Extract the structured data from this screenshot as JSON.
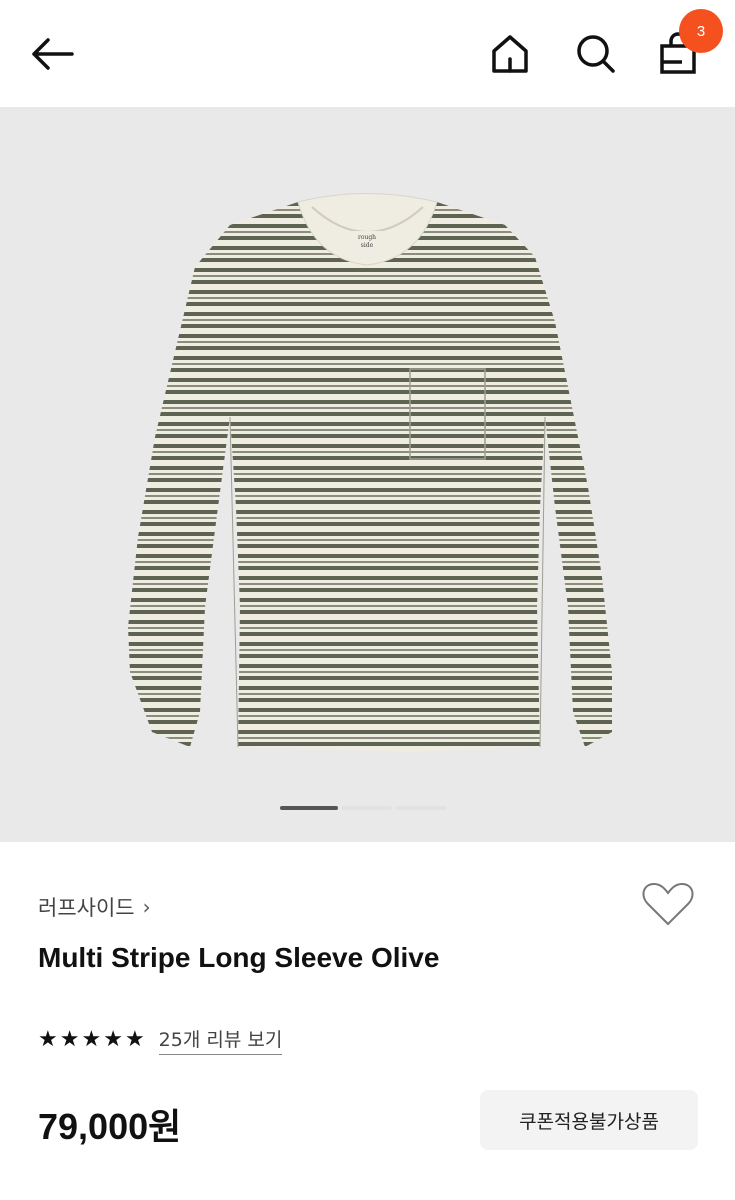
{
  "header": {
    "cart_count": "3",
    "icons": [
      "back-arrow-icon",
      "home-icon",
      "search-icon",
      "shopping-bag-icon"
    ]
  },
  "gallery": {
    "image_subject": "striped long sleeve t-shirt",
    "slide_count": 3,
    "active_slide": 1,
    "label_text": "rough side",
    "colors": {
      "background": "#e9e9e9",
      "fabric": "#efece2",
      "stripe": "#5e6352"
    }
  },
  "product": {
    "brand": "러프사이드",
    "brand_chevron": "›",
    "name": "Multi Stripe Long Sleeve Olive",
    "rating": 5,
    "review_link": "25개 리뷰 보기",
    "price": "79,000원",
    "coupon_label": "쿠폰적용불가상품"
  },
  "colors": {
    "badge": "#f4511e",
    "coupon_bg": "#f3f3f3"
  }
}
